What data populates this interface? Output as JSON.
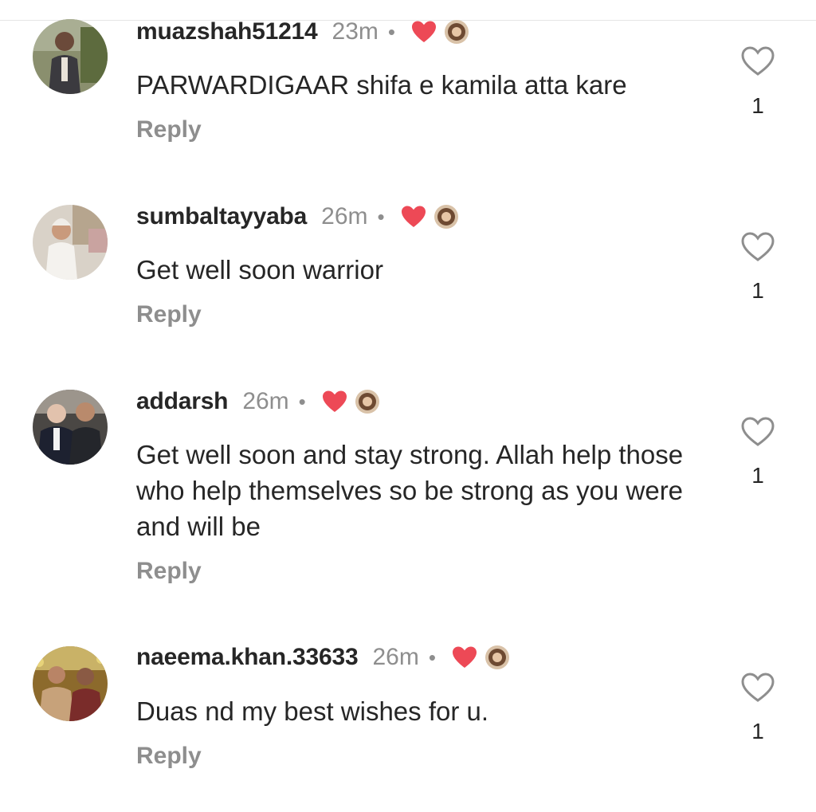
{
  "comments": [
    {
      "username": "muazshah51214",
      "time": "23m",
      "dot": "•",
      "text": "PARWARDIGAAR shifa e kamila atta kare",
      "reply_label": "Reply",
      "likes": "1",
      "liked_by_creator": true
    },
    {
      "username": "sumbaltayyaba",
      "time": "26m",
      "dot": "•",
      "text": "Get well soon warrior",
      "reply_label": "Reply",
      "likes": "1",
      "liked_by_creator": true
    },
    {
      "username": "addarsh",
      "time": "26m",
      "dot": "•",
      "text": "Get well soon and stay strong. Allah help those who help themselves so be strong as you were and will be",
      "reply_label": "Reply",
      "likes": "1",
      "liked_by_creator": true
    },
    {
      "username": "naeema.khan.33633",
      "time": "26m",
      "dot": "•",
      "text": "Duas nd my best wishes for u.",
      "reply_label": "Reply",
      "likes": "1",
      "liked_by_creator": true
    }
  ],
  "icons": {
    "like": "heart-outline-icon",
    "creator_like": "heart-filled-icon"
  },
  "colors": {
    "text": "#262626",
    "secondary": "#8e8e8e",
    "heart_red": "#ed4956"
  }
}
